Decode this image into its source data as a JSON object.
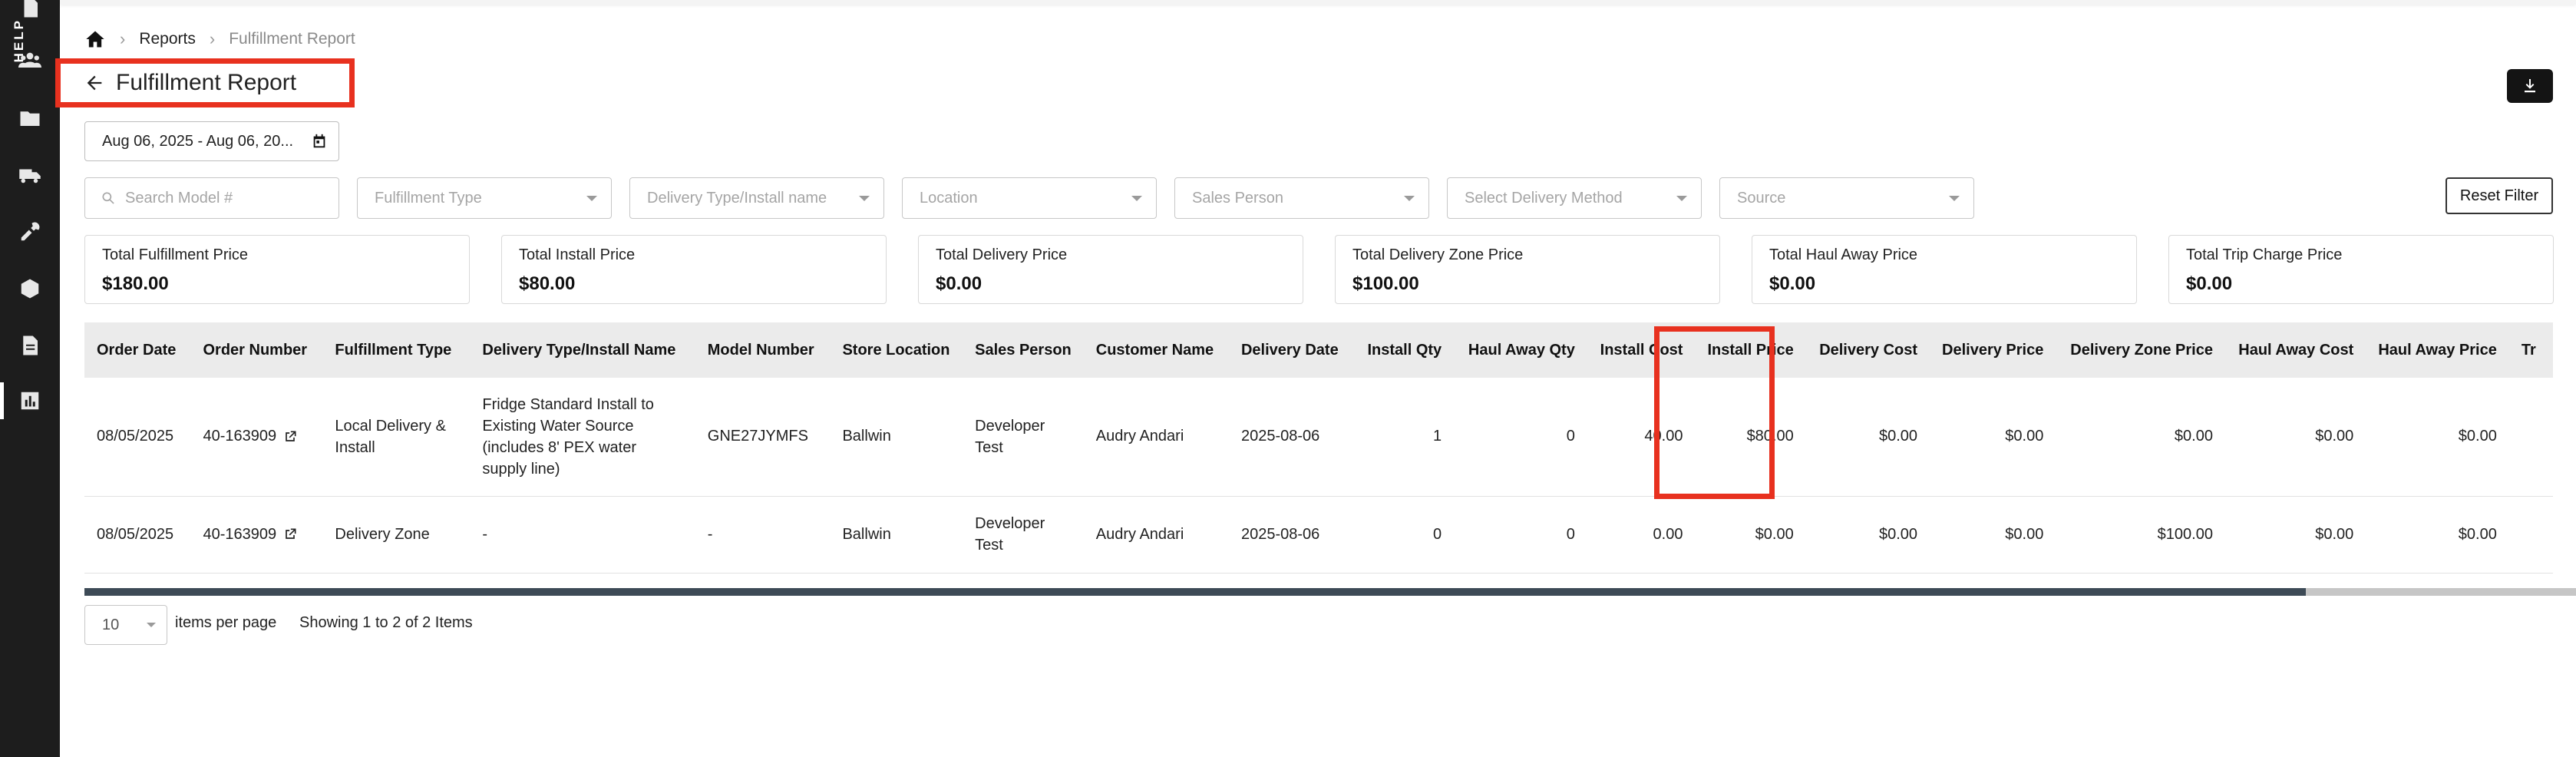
{
  "sidebar": {
    "icons": [
      "document-icon",
      "users-icon",
      "folder-icon",
      "truck-icon",
      "tools-icon",
      "box-icon",
      "file-icon",
      "bar-chart-icon"
    ],
    "active": "bar-chart-icon"
  },
  "breadcrumb": {
    "items": [
      "Reports",
      "Fulfillment Report"
    ]
  },
  "page": {
    "title": "Fulfillment Report"
  },
  "filters": {
    "date_range": "Aug 06, 2025 - Aug 06, 20...",
    "search_placeholder": "Search Model #",
    "fulfillment_type": "Fulfillment Type",
    "delivery_type": "Delivery Type/Install name",
    "location": "Location",
    "sales_person": "Sales Person",
    "delivery_method": "Select Delivery Method",
    "source": "Source",
    "reset_label": "Reset Filter"
  },
  "summary": [
    {
      "label": "Total Fulfillment Price",
      "value": "$180.00"
    },
    {
      "label": "Total Install Price",
      "value": "$80.00"
    },
    {
      "label": "Total Delivery Price",
      "value": "$0.00"
    },
    {
      "label": "Total Delivery Zone Price",
      "value": "$100.00"
    },
    {
      "label": "Total Haul Away Price",
      "value": "$0.00"
    },
    {
      "label": "Total Trip Charge Price",
      "value": "$0.00"
    }
  ],
  "table": {
    "columns": [
      "Order Date",
      "Order Number",
      "Fulfillment Type",
      "Delivery Type/Install Name",
      "Model Number",
      "Store Location",
      "Sales Person",
      "Customer Name",
      "Delivery Date",
      "Install Qty",
      "Haul Away Qty",
      "Install Cost",
      "Install Price",
      "Delivery Cost",
      "Delivery Price",
      "Delivery Zone Price",
      "Haul Away Cost",
      "Haul Away Price",
      "Tr"
    ],
    "rows": [
      {
        "order_date": "08/05/2025",
        "order_number": "40-163909",
        "fulfillment_type": "Local Delivery & Install",
        "delivery_type": "Fridge Standard Install to Existing Water Source (includes 8' PEX water supply line)",
        "model_number": "GNE27JYMFS",
        "store_location": "Ballwin",
        "sales_person": "Developer Test",
        "customer_name": "Audry Andari",
        "delivery_date": "2025-08-06",
        "install_qty": "1",
        "haul_away_qty": "0",
        "install_cost": "40.00",
        "install_price": "$80.00",
        "delivery_cost": "$0.00",
        "delivery_price": "$0.00",
        "delivery_zone_price": "$0.00",
        "haul_away_cost": "$0.00",
        "haul_away_price": "$0.00"
      },
      {
        "order_date": "08/05/2025",
        "order_number": "40-163909",
        "fulfillment_type": "Delivery Zone",
        "delivery_type": "-",
        "model_number": "-",
        "store_location": "Ballwin",
        "sales_person": "Developer Test",
        "customer_name": "Audry Andari",
        "delivery_date": "2025-08-06",
        "install_qty": "0",
        "haul_away_qty": "0",
        "install_cost": "0.00",
        "install_price": "$0.00",
        "delivery_cost": "$0.00",
        "delivery_price": "$0.00",
        "delivery_zone_price": "$100.00",
        "haul_away_cost": "$0.00",
        "haul_away_price": "$0.00"
      }
    ]
  },
  "pagination": {
    "per_page": "10",
    "per_page_label": "items per page",
    "showing": "Showing 1 to 2 of 2 Items"
  },
  "help": {
    "label": "HELP"
  },
  "colors": {
    "highlight": "#e8311f",
    "sidebar_bg": "#1d1d1d",
    "help_bg": "#ea4a5e"
  }
}
